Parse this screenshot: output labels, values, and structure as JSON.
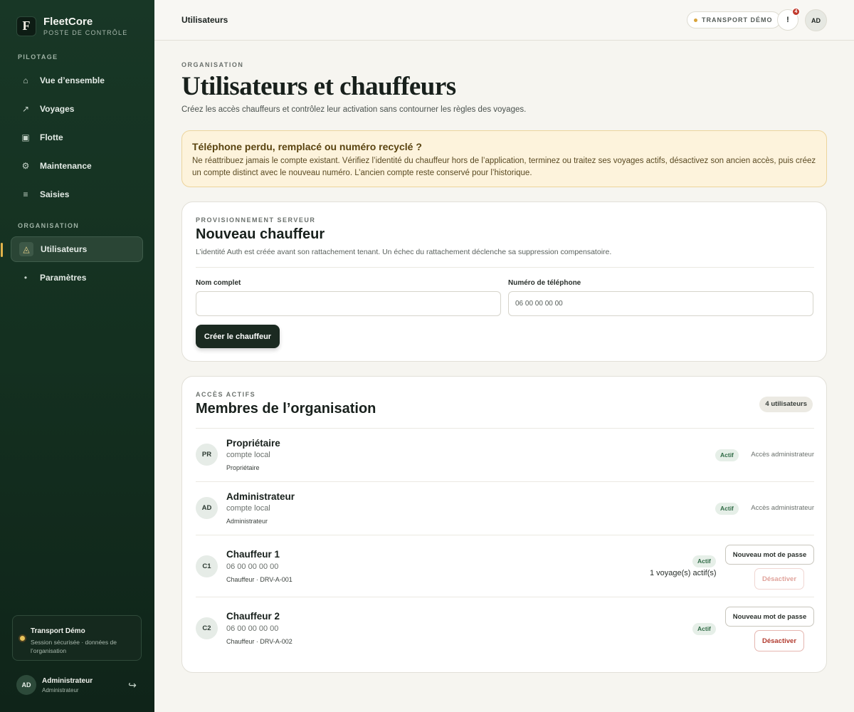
{
  "brand": {
    "logo_letter": "F",
    "name": "FleetCore",
    "subtitle": "POSTE DE CONTRÔLE"
  },
  "sidebar": {
    "sections": [
      {
        "label": "PILOTAGE"
      },
      {
        "label": "ORGANISATION"
      }
    ],
    "items": [
      {
        "label": "Vue d’ensemble",
        "icon": "home-icon",
        "glyph": "⌂"
      },
      {
        "label": "Voyages",
        "icon": "arrow-up-right-icon",
        "glyph": "↗"
      },
      {
        "label": "Flotte",
        "icon": "truck-icon",
        "glyph": "▣"
      },
      {
        "label": "Maintenance",
        "icon": "gear-icon",
        "glyph": "⚙"
      },
      {
        "label": "Saisies",
        "icon": "list-icon",
        "glyph": "≡"
      },
      {
        "label": "Utilisateurs",
        "icon": "users-icon",
        "glyph": "◬",
        "active": true
      },
      {
        "label": "Paramètres",
        "icon": "dot-icon",
        "glyph": "•"
      }
    ],
    "tenant_card": {
      "name": "Transport Démo",
      "description": "Session sécurisée · données de l’organisation"
    },
    "user": {
      "initials": "AD",
      "name": "Administrateur",
      "role": "Administrateur"
    }
  },
  "topbar": {
    "title": "Utilisateurs",
    "tenant_pill": "TRANSPORT DÉMO",
    "alert_glyph": "!",
    "notification_count": "4",
    "avatar_initials": "AD"
  },
  "page": {
    "eyebrow": "ORGANISATION",
    "title": "Utilisateurs et chauffeurs",
    "description": "Créez les accès chauffeurs et contrôlez leur activation sans contourner les règles des voyages."
  },
  "warning": {
    "title": "Téléphone perdu, remplacé ou numéro recyclé ?",
    "text": "Ne réattribuez jamais le compte existant. Vérifiez l’identité du chauffeur hors de l’application, terminez ou traitez ses voyages actifs, désactivez son ancien accès, puis créez un compte distinct avec le nouveau numéro. L’ancien compte reste conservé pour l’historique."
  },
  "new_driver": {
    "eyebrow": "PROVISIONNEMENT SERVEUR",
    "title": "Nouveau chauffeur",
    "description": "L’identité Auth est créée avant son rattachement tenant. Un échec du rattachement déclenche sa suppression compensatoire.",
    "name_label": "Nom complet",
    "name_value": "",
    "phone_label": "Numéro de téléphone",
    "phone_placeholder": "06 00 00 00 00",
    "submit_label": "Créer le chauffeur"
  },
  "members": {
    "eyebrow": "ACCÈS ACTIFS",
    "title": "Membres de l’organisation",
    "count_label": "4 utilisateurs",
    "rows": [
      {
        "initials": "PR",
        "name": "Propriétaire",
        "sub": "compte local",
        "role": "Propriétaire",
        "status": "Actif",
        "access": "Accès administrateur"
      },
      {
        "initials": "AD",
        "name": "Administrateur",
        "sub": "compte local",
        "role": "Administrateur",
        "status": "Actif",
        "access": "Accès administrateur"
      },
      {
        "initials": "C1",
        "name": "Chauffeur 1",
        "sub": "06 00 00 00 00",
        "role": "Chauffeur · DRV-A-001",
        "status": "Actif",
        "trips": "1 voyage(s) actif(s)",
        "reset_label": "Nouveau mot de passe",
        "deactivate_label": "Désactiver",
        "deactivate_disabled": true
      },
      {
        "initials": "C2",
        "name": "Chauffeur 2",
        "sub": "06 00 00 00 00",
        "role": "Chauffeur · DRV-A-002",
        "status": "Actif",
        "reset_label": "Nouveau mot de passe",
        "deactivate_label": "Désactiver",
        "deactivate_disabled": false
      }
    ]
  },
  "colors": {
    "sidebar_bg": "#183726",
    "accent_gold": "#e0b24a",
    "warning_bg": "#fdf3dc",
    "primary_button": "#1b2a21",
    "danger": "#b23a2e",
    "status_green": "#2f6a45"
  }
}
